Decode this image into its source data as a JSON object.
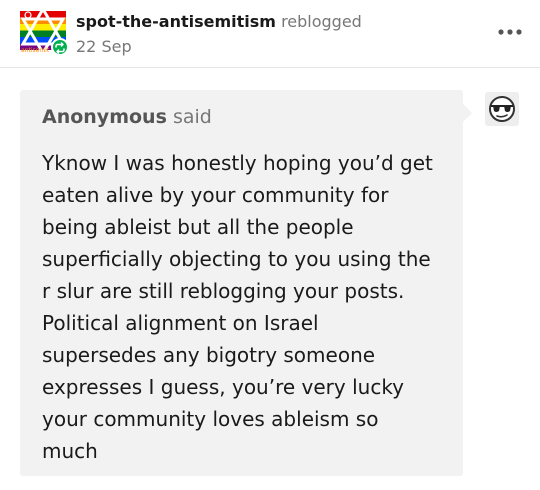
{
  "post": {
    "blog_name": "spot-the-antisemitism",
    "action_label": "reblogged",
    "date": "22 Sep",
    "more_icon": "more-horizontal-icon",
    "avatar_watermark": "antisemit"
  },
  "ask": {
    "asker": "Anonymous",
    "said_label": "said",
    "avatar_icon": "anonymous-sunglasses-icon",
    "question_lines": [
      "Yknow I was honestly hoping you’d get",
      "eaten alive by your community for",
      "being ableist but all the people",
      "superficially objecting to you using the",
      "r slur are still reblogging your posts.",
      "Political alignment on Israel",
      "supersedes any bigotry someone",
      "expresses I guess, you’re very lucky",
      "your community loves ableism so",
      "much"
    ]
  },
  "colors": {
    "ask_background": "#f2f2f2",
    "reblog_green": "#00b04f",
    "muted_text": "#777777"
  }
}
